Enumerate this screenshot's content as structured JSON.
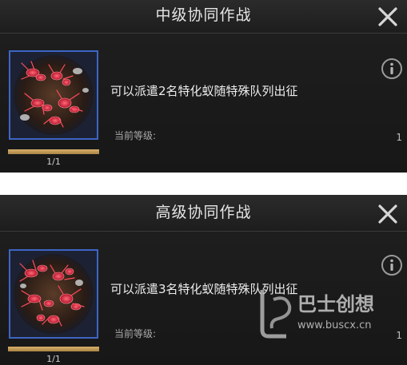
{
  "panels": [
    {
      "title": "中级协同作战",
      "description": "可以派遣2名特化蚁随特殊队列出征",
      "level_label": "当前等级:",
      "level_value": "1",
      "progress_text": "1/1",
      "progress_fraction": 1.0,
      "close_icon": "close-icon",
      "info_icon": "info-icon"
    },
    {
      "title": "高级协同作战",
      "description": "可以派遣3名特化蚁随特殊队列出征",
      "level_label": "当前等级:",
      "level_value": "1",
      "progress_text": "1/1",
      "progress_fraction": 1.0,
      "close_icon": "close-icon",
      "info_icon": "info-icon"
    }
  ],
  "watermark": {
    "brand": "巴士创想",
    "url": "www.buscx.cn"
  },
  "colors": {
    "panel_bg": "#1a1a1a",
    "icon_border": "#3d65c4",
    "progress_fill": "#c9a15a",
    "title_text": "#e6e6e6"
  }
}
